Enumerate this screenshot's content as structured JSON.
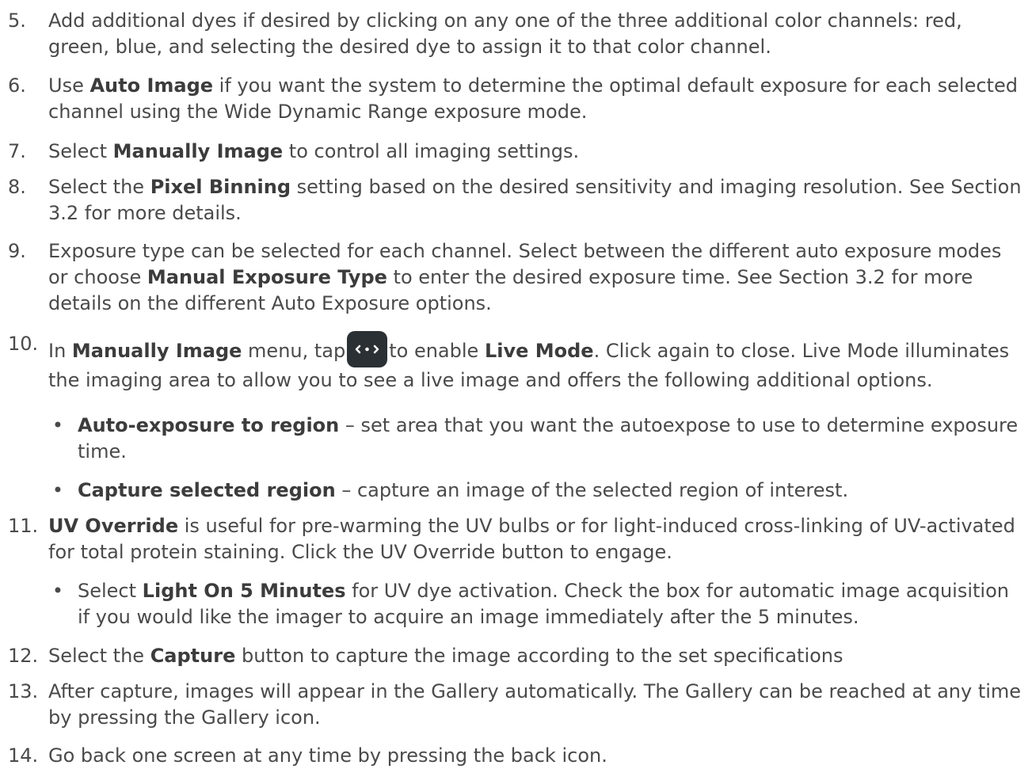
{
  "items": [
    {
      "num": "5.",
      "text": "Add additional dyes if desired by clicking on any one of the three additional color channels: red, green, blue, and selecting the desired dye to assign it to that color channel."
    },
    {
      "num": "6.",
      "pre": "Use ",
      "b1": "Auto Image",
      "post": " if you want the system to determine the optimal default exposure for each selected channel using the Wide Dynamic Range exposure mode."
    },
    {
      "num": "7.",
      "pre": "Select ",
      "b1": "Manually Image",
      "post": " to control all imaging settings."
    },
    {
      "num": "8.",
      "pre": "Select the ",
      "b1": "Pixel Binning",
      "post": " setting based on the desired sensitivity and imaging resolution. See Section 3.2 for more details."
    },
    {
      "num": "9.",
      "pre": "Exposure type can be selected for each channel. Select between the different auto exposure modes or choose ",
      "b1": "Manual Exposure Type",
      "post": " to enter the desired exposure time. See Section 3.2 for more details on the different Auto Exposure options."
    },
    {
      "num": "10.",
      "pre": "In ",
      "b1": "Manually Image",
      "mid1": " menu, tap",
      "mid2": "to enable ",
      "b2": "Live Mode",
      "post": ". Click again to close. Live Mode illuminates the imaging area to allow you to see a live image and offers the following additional options."
    },
    {
      "num": "11.",
      "b1": "UV Override",
      "post": " is useful for pre-warming the UV bulbs or for light-induced cross-linking of UV-activated for total protein staining. Click the UV Override button to engage."
    },
    {
      "num": "12.",
      "pre": "Select the ",
      "b1": "Capture",
      "post": " button to capture the image according to the set specifications"
    },
    {
      "num": "13.",
      "text": "After capture, images will appear in the Gallery automatically. The Gallery can be reached at any time by pressing the Gallery icon."
    },
    {
      "num": "14.",
      "text": "Go back one screen at any time by pressing the back icon."
    }
  ],
  "subitems": [
    {
      "bullet": "•",
      "b1": "Auto-exposure to region",
      "post": " – set area that you want the autoexpose to use to determine exposure time."
    },
    {
      "bullet": "•",
      "b1": "Capture selected region",
      "post": " – capture an image of the selected region of interest."
    },
    {
      "bullet": "•",
      "pre": "Select ",
      "b1": "Light On 5 Minutes",
      "post": " for UV dye activation. Check the box for automatic image acquisition if you would like the imager to acquire an image immediately after the 5 minutes."
    }
  ],
  "icons": {
    "live_mode": "live-mode-icon",
    "live_mode_bg": "#2b3034"
  }
}
